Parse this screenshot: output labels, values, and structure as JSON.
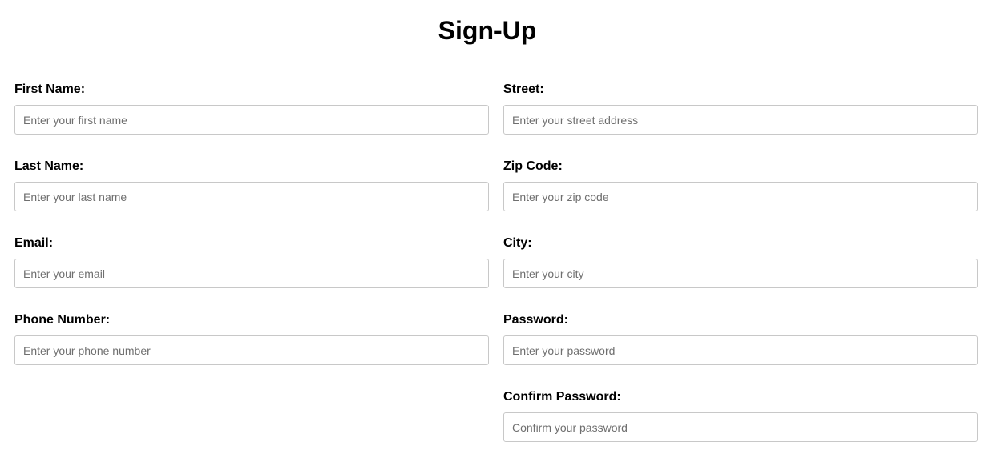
{
  "page": {
    "title": "Sign-Up"
  },
  "form": {
    "left": [
      {
        "id": "first-name",
        "label": "First Name:",
        "placeholder": "Enter your first name",
        "value": ""
      },
      {
        "id": "last-name",
        "label": "Last Name:",
        "placeholder": "Enter your last name",
        "value": ""
      },
      {
        "id": "email",
        "label": "Email:",
        "placeholder": "Enter your email",
        "value": ""
      },
      {
        "id": "phone-number",
        "label": "Phone Number:",
        "placeholder": "Enter your phone number",
        "value": ""
      }
    ],
    "right": [
      {
        "id": "street",
        "label": "Street:",
        "placeholder": "Enter your street address",
        "value": ""
      },
      {
        "id": "zip-code",
        "label": "Zip Code:",
        "placeholder": "Enter your zip code",
        "value": ""
      },
      {
        "id": "city",
        "label": "City:",
        "placeholder": "Enter your city",
        "value": ""
      },
      {
        "id": "password",
        "label": "Password:",
        "placeholder": "Enter your password",
        "value": ""
      },
      {
        "id": "confirm-password",
        "label": "Confirm Password:",
        "placeholder": "Confirm your password",
        "value": ""
      }
    ]
  }
}
